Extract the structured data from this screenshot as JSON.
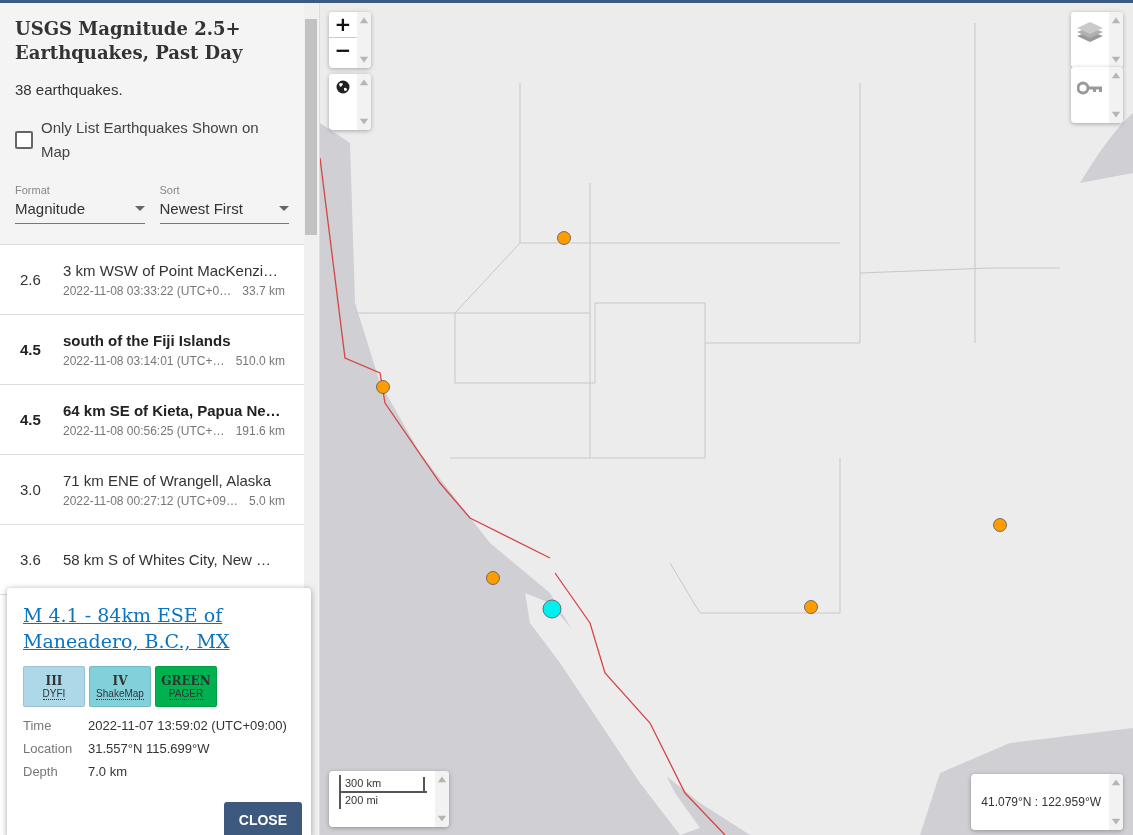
{
  "sidebar": {
    "title": "USGS Magnitude 2.5+ Earthquakes, Past Day",
    "count": "38 earthquakes.",
    "filter": {
      "label": "Only List Earthquakes Shown on Map",
      "checked": false
    },
    "selects": [
      {
        "label": "Format",
        "value": "Magnitude"
      },
      {
        "label": "Sort",
        "value": "Newest First"
      }
    ]
  },
  "earthquakes": [
    {
      "magnitude": "2.6",
      "title": "3 km WSW of Point MacKenzi…",
      "time": "2022-11-08 03:33:22 (UTC+0…",
      "depth": "33.7 km",
      "emphasized": false
    },
    {
      "magnitude": "4.5",
      "title": "south of the Fiji Islands",
      "time": "2022-11-08 03:14:01 (UTC+…",
      "depth": "510.0 km",
      "emphasized": true
    },
    {
      "magnitude": "4.5",
      "title": "64 km SE of Kieta, Papua Ne…",
      "time": "2022-11-08 00:56:25 (UTC+…",
      "depth": "191.6 km",
      "emphasized": true
    },
    {
      "magnitude": "3.0",
      "title": "71 km ENE of Wrangell, Alaska",
      "time": "2022-11-08 00:27:12 (UTC+09…",
      "depth": "5.0 km",
      "emphasized": false
    },
    {
      "magnitude": "3.6",
      "title": "58 km S of Whites City, New …",
      "emphasized": false
    }
  ],
  "map": {
    "kind": "picture",
    "zoom_buttons": [
      "+",
      "−"
    ],
    "scale": [
      "300 km",
      "200 mi"
    ],
    "coordinates": "41.079°N : 122.959°W"
  },
  "popup": {
    "title": "M 4.1 - 84km ESE of Maneadero, B.C., MX",
    "badges": [
      {
        "value": "III",
        "label": "DYFI",
        "color": "#acd8e8"
      },
      {
        "value": "IV",
        "label": "ShakeMap",
        "color": "#82d0da"
      },
      {
        "value": "GREEN",
        "label": "PAGER",
        "color": "#00b14f"
      }
    ],
    "details": [
      {
        "label": "Time",
        "value": "2022-11-07 13:59:02 (UTC+09:00)"
      },
      {
        "label": "Location",
        "value": "31.557°N 115.699°W"
      },
      {
        "label": "Depth",
        "value": "7.0 km"
      }
    ],
    "close": "CLOSE"
  }
}
